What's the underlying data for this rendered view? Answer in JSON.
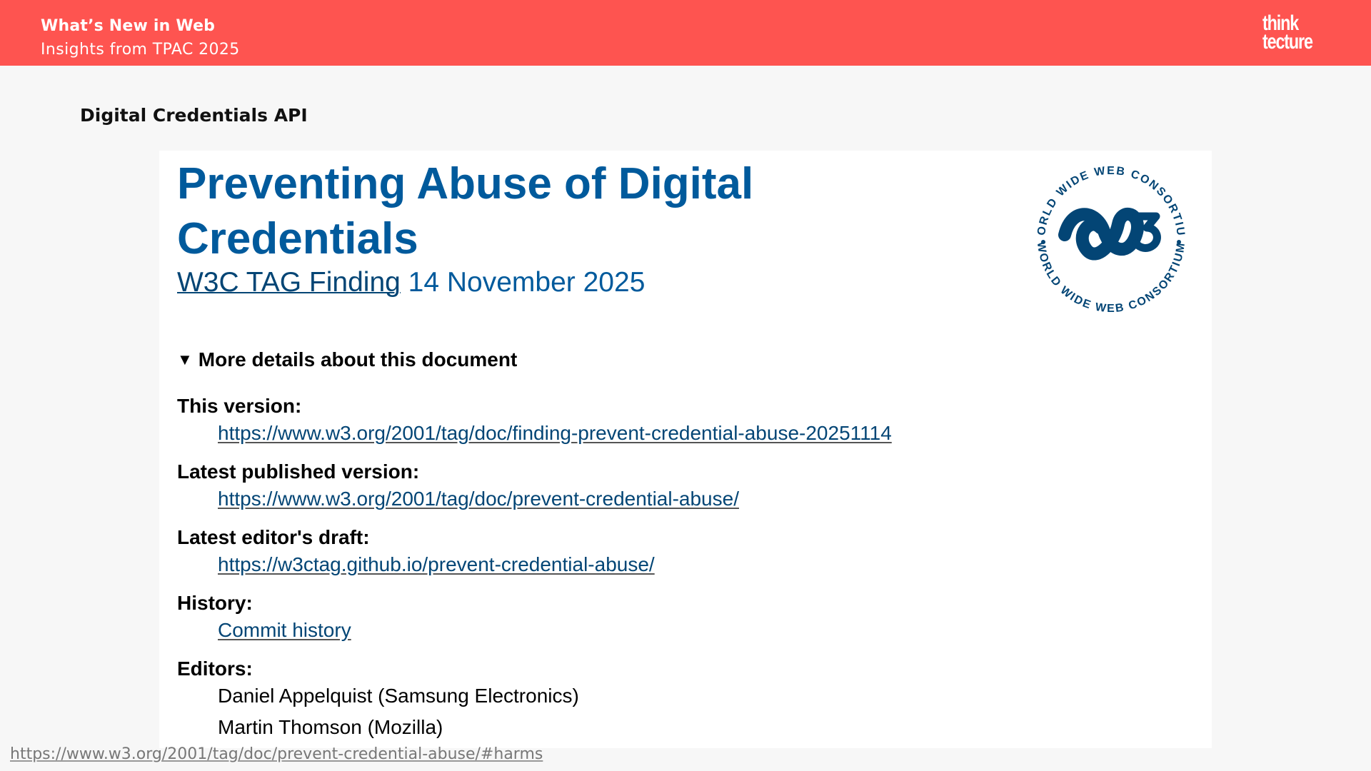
{
  "header": {
    "title": "What’s New in Web",
    "subtitle": "Insights from TPAC 2025",
    "logo_line1": "think",
    "logo_line2": "tecture",
    "background_color": "#fe5450"
  },
  "section_title": "Digital Credentials API",
  "document": {
    "title_line1": "Preventing Abuse of Digital",
    "title_line2": "Credentials",
    "subtitle_link": "W3C TAG Finding",
    "subtitle_date": "14 November 2025",
    "seal_top_text": "WORLD WIDE WEB CONSORTIUM",
    "seal_bottom_text": "WORLD WIDE WEB CONSORTIUM",
    "title_color": "#005a9c",
    "details_summary": "More details about this document",
    "details_marker": "▼",
    "details": [
      {
        "label": "This version:",
        "values": [
          "https://www.w3.org/2001/tag/doc/finding-prevent-credential-abuse-20251114"
        ]
      },
      {
        "label": "Latest published version:",
        "values": [
          "https://www.w3.org/2001/tag/doc/prevent-credential-abuse/"
        ]
      },
      {
        "label": "Latest editor's draft:",
        "values": [
          "https://w3ctag.github.io/prevent-credential-abuse/"
        ]
      },
      {
        "label": "History:",
        "values": [
          "Commit history"
        ]
      },
      {
        "label": "Editors:",
        "values": [
          "Daniel Appelquist (Samsung Electronics)",
          "Martin Thomson (Mozilla)"
        ]
      }
    ]
  },
  "footer_link": "https://www.w3.org/2001/tag/doc/prevent-credential-abuse/#harms"
}
